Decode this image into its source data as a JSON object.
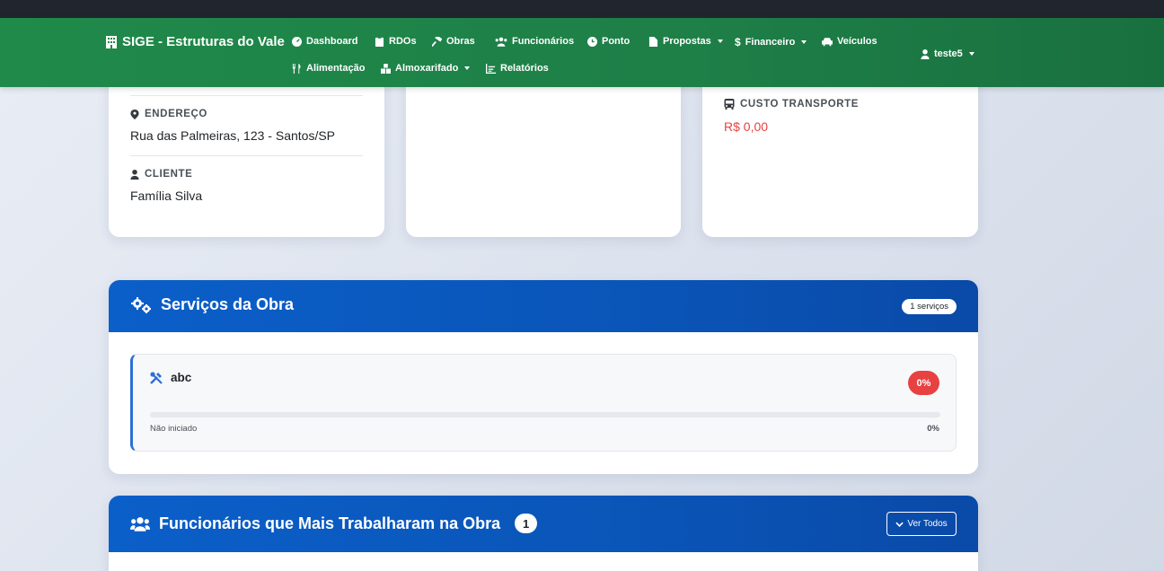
{
  "navbar": {
    "brand": "SIGE - Estruturas do Vale",
    "items": [
      {
        "label": "Dashboard",
        "icon": "dashboard-icon"
      },
      {
        "label": "RDOs",
        "icon": "clipboard-icon"
      },
      {
        "label": "Obras",
        "icon": "hammer-icon"
      },
      {
        "label": "Funcionários",
        "icon": "users-icon"
      },
      {
        "label": "Ponto",
        "icon": "clock-icon"
      },
      {
        "label": "Propostas",
        "icon": "file-icon",
        "dropdown": true
      },
      {
        "label": "Financeiro",
        "icon": "dollar-icon",
        "dropdown": true
      },
      {
        "label": "Veículos",
        "icon": "car-icon"
      },
      {
        "label": "Alimentação",
        "icon": "utensils-icon"
      },
      {
        "label": "Almoxarifado",
        "icon": "boxes-icon",
        "dropdown": true
      },
      {
        "label": "Relatórios",
        "icon": "chart-icon"
      }
    ],
    "user": "teste5"
  },
  "info_card": {
    "endereco_label": "ENDEREÇO",
    "endereco_value": "Rua das Palmeiras, 123 - Santos/SP",
    "cliente_label": "CLIENTE",
    "cliente_value": "Família Silva"
  },
  "cost_card": {
    "transporte_label": "CUSTO TRANSPORTE",
    "transporte_value": "R$ 0,00"
  },
  "services": {
    "title": "Serviços da Obra",
    "count_badge": "1 serviços",
    "items": [
      {
        "name": "abc",
        "percent_badge": "0%",
        "progress": 0,
        "status": "Não iniciado",
        "percent_text": "0%"
      }
    ]
  },
  "workers": {
    "title": "Funcionários que Mais Trabalharam na Obra",
    "count": "1",
    "button_label": "Ver Todos"
  },
  "colors": {
    "nav_green": "#1f8a4a",
    "section_blue": "#0b5fc9",
    "danger": "#e84142",
    "accent_blue": "#2f6fd6"
  }
}
